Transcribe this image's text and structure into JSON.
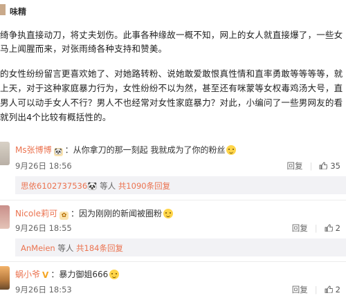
{
  "article": {
    "author": "味精",
    "lines": [
      "绮争执直接动刀，将丈夫划伤。此事各种缘故一概不知，网上的女人就直接爆了，一些女",
      "马上闻腥而来，对张雨绮各种支持和赞美。",
      "的女性纷纷留言更喜欢她了、对她路转粉、说她敢爱敢恨真性情和直率勇敢等等等等，就",
      "上天，对于这种家庭暴力行为，女性纷纷不以为然，甚至还有咪蒙等女权毒鸡汤大号，直",
      "男人可以动手女人不行？男人不也经常对女性家庭暴力？对此，小编问了一些男网友的看",
      "就列出4个比较有概括性的。"
    ]
  },
  "comments": [
    {
      "username": "Ms张博博",
      "badge": "🐼",
      "text": "从你拿刀的那一刻起 我就成为了你的粉丝",
      "time": "9月26日 18:56",
      "reply_label": "回复",
      "like_count": "35",
      "reply_summary": {
        "user": "思依6102737536",
        "badge": "🐼",
        "middle": " 等人 ",
        "count_text": "共1090条回复"
      }
    },
    {
      "username": "Nicole莉可",
      "badge": "✿",
      "text": "因为刚刚的新闻被圈粉",
      "time": "9月26日 18:55",
      "reply_label": "回复",
      "like_count": "2",
      "reply_summary": {
        "user": "AnMeien",
        "badge": "",
        "middle": " 等人 ",
        "count_text": "共184条回复"
      }
    },
    {
      "username": "蜗小爷",
      "badge": "V",
      "text": "暴力御姐666",
      "time": "9月26日 18:53",
      "reply_label": "回复",
      "like_count": "2"
    }
  ]
}
